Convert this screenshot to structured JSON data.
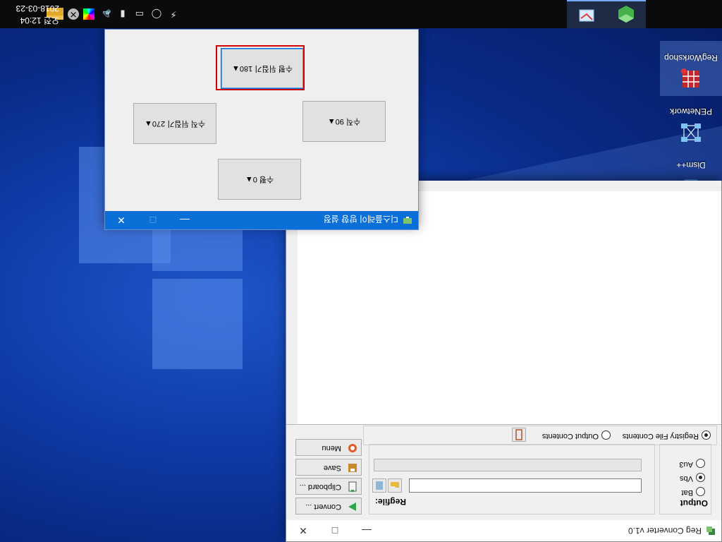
{
  "desktop": {
    "icons": [
      {
        "label": "RegWorkshop",
        "icon": "grid-icon"
      },
      {
        "label": "PENetwork",
        "icon": "network-icon"
      },
      {
        "label": "Dism++",
        "icon": "dism-icon"
      }
    ]
  },
  "taskbar": {
    "apps": [
      "folder-app",
      "3d-cube-app",
      "display-settings-app"
    ],
    "tray": [
      "network-icon",
      "usb-drive-icon",
      "device-icon",
      "speaker-icon",
      "color-wheel-icon",
      "close-circle-icon"
    ],
    "clock": {
      "time": "오전 12:04",
      "date": "2018-03-23"
    }
  },
  "regconverter": {
    "title": "Reg Converter v1.0",
    "buttons": {
      "convert": "Convert ...",
      "clipboard": "Clipboard ...",
      "save": "Save",
      "menu": "Menu"
    },
    "regfile_label": "Regfile:",
    "output_label": "Output",
    "output_options": [
      "Bat",
      "Vbs",
      "Au3"
    ],
    "output_selected": "Vbs",
    "view_options": [
      "Registry File Contents",
      "Output Contents"
    ],
    "view_selected": "Registry File Contents"
  },
  "display_window": {
    "title": "디스플레이 방향 설정",
    "buttons": {
      "landscape_0": "수평 0▲",
      "portrait_90": "수직 90▲",
      "portrait_flipped_270": "수직 뒤집기 270▲",
      "landscape_flipped_180": "수평 뒤집기 180▲"
    }
  },
  "colors": {
    "accent": "#0a6fd6",
    "focus": "#d40000",
    "taskbar": "#0b0b0b"
  }
}
